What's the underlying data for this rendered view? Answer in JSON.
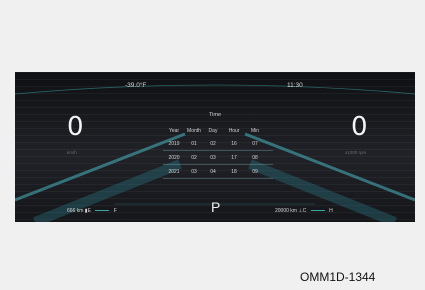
{
  "status": {
    "outside_temp": "-39.0°F",
    "clock": "11:30"
  },
  "gauges": {
    "left": {
      "value": "0",
      "unit": "km/h"
    },
    "right": {
      "value": "0",
      "unit": "x1000 rpm"
    }
  },
  "time_table": {
    "title": "Time",
    "headers": [
      "Year",
      "Month",
      "Day",
      "Hour",
      "Min"
    ],
    "rows": [
      [
        "2019",
        "01",
        "02",
        "16",
        "07"
      ],
      [
        "2020",
        "02",
        "03",
        "17",
        "08"
      ],
      [
        "2021",
        "03",
        "04",
        "18",
        "09"
      ]
    ]
  },
  "bottom": {
    "range": "666 km",
    "fuel_low": "E",
    "fuel_high": "F",
    "gear": "P",
    "odometer": "20000 km",
    "temp_low": "C",
    "temp_high": "H"
  },
  "figure_code": "OMM1D-1344",
  "colors": {
    "accent": "#3aa6a6",
    "panel_bg": "#1b1c20",
    "page_bg": "#f0f0f0"
  }
}
